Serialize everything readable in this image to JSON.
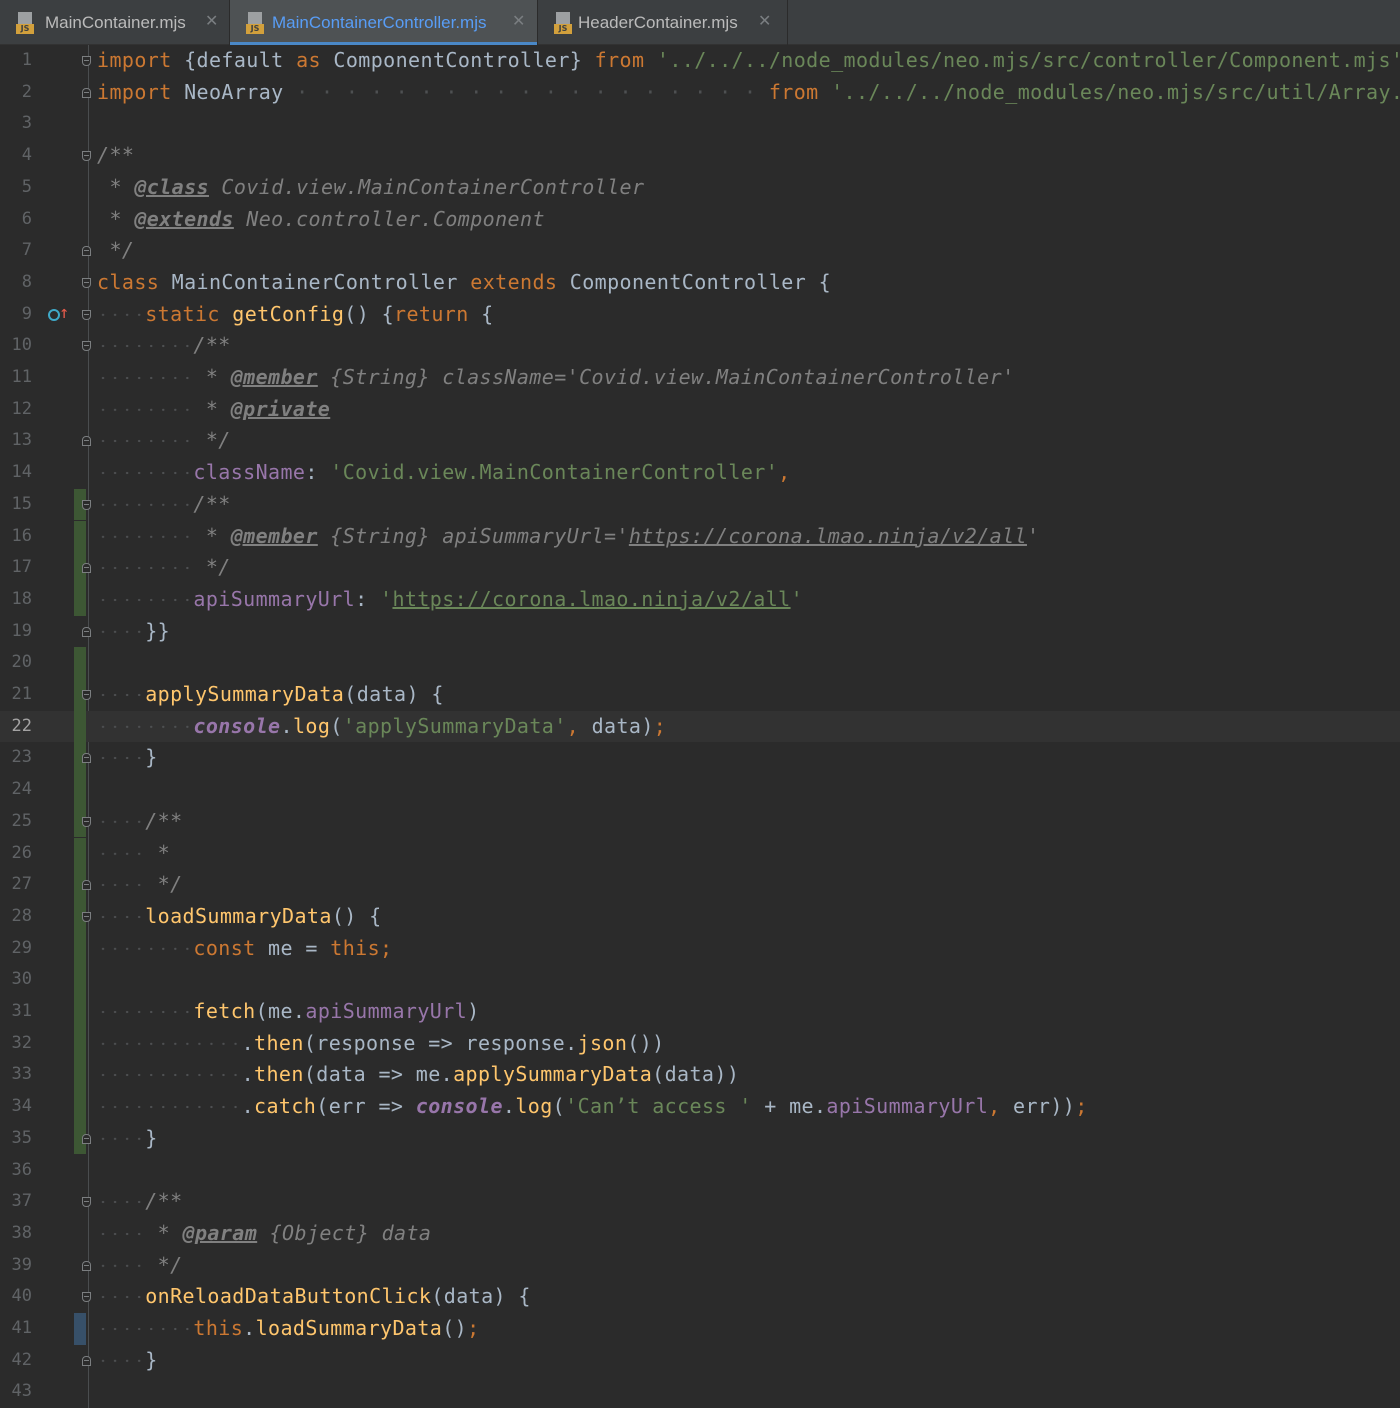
{
  "tabs": [
    {
      "label": "MainContainer.mjs",
      "active": false,
      "icon": "js-file-icon",
      "badge": "JS"
    },
    {
      "label": "MainContainerController.mjs",
      "active": true,
      "icon": "js-file-icon",
      "badge": "JS"
    },
    {
      "label": "HeaderContainer.mjs",
      "active": false,
      "icon": "js-file-icon",
      "badge": "JS"
    }
  ],
  "close_glyph": "✕",
  "editor": {
    "current_line": 22,
    "colors": {
      "keyword": "#cc7832",
      "string": "#6a8759",
      "comment": "#808080",
      "function": "#ffc66d",
      "property": "#9876aa",
      "text": "#a9b7c6",
      "background": "#2b2b2b",
      "gutter_added": "#3d5734",
      "gutter_modified": "#375069"
    },
    "lines": [
      {
        "n": "1",
        "indent": 0,
        "fold": "start",
        "tokens": [
          [
            "kw",
            "import"
          ],
          [
            "",
            " {default "
          ],
          [
            "kw",
            "as"
          ],
          [
            "",
            " ComponentController} "
          ],
          [
            "kw",
            "from"
          ],
          [
            "",
            " "
          ],
          [
            "str",
            "'../../../node_modules/neo.mjs/src/controller/Component.mjs'"
          ],
          [
            "kw",
            ";"
          ]
        ]
      },
      {
        "n": "2",
        "indent": 0,
        "fold": "end",
        "tokens": [
          [
            "kw",
            "import"
          ],
          [
            "",
            " NeoArray"
          ],
          [
            "ws",
            " · · · · · · · · · · · · · · · · · · ·"
          ],
          [
            "",
            " "
          ],
          [
            "kw",
            "from"
          ],
          [
            "",
            " "
          ],
          [
            "str",
            "'../../../node_modules/neo.mjs/src/util/Array.mjs'"
          ],
          [
            "kw",
            ";"
          ]
        ]
      },
      {
        "n": "3",
        "indent": 0,
        "tokens": []
      },
      {
        "n": "4",
        "indent": 0,
        "fold": "start",
        "tokens": [
          [
            "cmt",
            "/**"
          ]
        ]
      },
      {
        "n": "5",
        "indent": 0,
        "tokens": [
          [
            "cmt",
            " * "
          ],
          [
            "tag",
            "@class"
          ],
          [
            "cmt",
            " Covid.view.MainContainerController"
          ]
        ]
      },
      {
        "n": "6",
        "indent": 0,
        "tokens": [
          [
            "cmt",
            " * "
          ],
          [
            "tag",
            "@extends"
          ],
          [
            "cmt",
            " Neo.controller.Component"
          ]
        ]
      },
      {
        "n": "7",
        "indent": 0,
        "fold": "end",
        "tokens": [
          [
            "cmt",
            " */"
          ]
        ]
      },
      {
        "n": "8",
        "indent": 0,
        "fold": "start",
        "tokens": [
          [
            "kw",
            "class"
          ],
          [
            "",
            " MainContainerController "
          ],
          [
            "kw",
            "extends"
          ],
          [
            "",
            " ComponentController {"
          ]
        ]
      },
      {
        "n": "9",
        "indent": 4,
        "fold": "start",
        "marker": "override",
        "tokens": [
          [
            "kw",
            "static"
          ],
          [
            "",
            " "
          ],
          [
            "fn",
            "getConfig"
          ],
          [
            "",
            "() {"
          ],
          [
            "kw",
            "return"
          ],
          [
            "",
            " {"
          ]
        ]
      },
      {
        "n": "10",
        "indent": 8,
        "fold": "start",
        "tokens": [
          [
            "cmt",
            "/**"
          ]
        ]
      },
      {
        "n": "11",
        "indent": 8,
        "tokens": [
          [
            "cmt",
            " * "
          ],
          [
            "tag",
            "@member"
          ],
          [
            "cmt",
            " {String} className='Covid.view.MainContainerController'"
          ]
        ]
      },
      {
        "n": "12",
        "indent": 8,
        "tokens": [
          [
            "cmt",
            " * "
          ],
          [
            "tag",
            "@private"
          ]
        ]
      },
      {
        "n": "13",
        "indent": 8,
        "fold": "end",
        "tokens": [
          [
            "cmt",
            " */"
          ]
        ]
      },
      {
        "n": "14",
        "indent": 8,
        "tokens": [
          [
            "prop",
            "className"
          ],
          [
            "",
            ": "
          ],
          [
            "str",
            "'Covid.view.MainContainerController'"
          ],
          [
            "kw",
            ","
          ]
        ]
      },
      {
        "n": "15",
        "indent": 8,
        "fold": "start",
        "change": "added",
        "tokens": [
          [
            "cmt",
            "/**"
          ]
        ]
      },
      {
        "n": "16",
        "indent": 8,
        "change": "added",
        "tokens": [
          [
            "cmt",
            " * "
          ],
          [
            "tag",
            "@member"
          ],
          [
            "cmt",
            " {String} apiSummaryUrl='"
          ],
          [
            "cmturl",
            "https://corona.lmao.ninja/v2/all"
          ],
          [
            "cmt",
            "'"
          ]
        ]
      },
      {
        "n": "17",
        "indent": 8,
        "fold": "end",
        "change": "added",
        "tokens": [
          [
            "cmt",
            " */"
          ]
        ]
      },
      {
        "n": "18",
        "indent": 8,
        "change": "added",
        "tokens": [
          [
            "prop",
            "apiSummaryUrl"
          ],
          [
            "",
            ": "
          ],
          [
            "str",
            "'"
          ],
          [
            "strurl",
            "https://corona.lmao.ninja/v2/all"
          ],
          [
            "str",
            "'"
          ]
        ]
      },
      {
        "n": "19",
        "indent": 4,
        "fold": "end",
        "tokens": [
          [
            "",
            "}}"
          ]
        ]
      },
      {
        "n": "20",
        "indent": 0,
        "change": "added",
        "tokens": []
      },
      {
        "n": "21",
        "indent": 4,
        "fold": "start",
        "change": "added",
        "tokens": [
          [
            "fn",
            "applySummaryData"
          ],
          [
            "",
            "(data) {"
          ]
        ]
      },
      {
        "n": "22",
        "indent": 8,
        "change": "added",
        "tokens": [
          [
            "global",
            "console"
          ],
          [
            "",
            "."
          ],
          [
            "fn",
            "log"
          ],
          [
            "",
            "("
          ],
          [
            "str",
            "'applySummaryData'"
          ],
          [
            "kw",
            ","
          ],
          [
            "",
            " data)"
          ],
          [
            "kw",
            ";"
          ]
        ]
      },
      {
        "n": "23",
        "indent": 4,
        "fold": "end",
        "change": "added",
        "tokens": [
          [
            "",
            "}"
          ]
        ]
      },
      {
        "n": "24",
        "indent": 0,
        "change": "added",
        "tokens": []
      },
      {
        "n": "25",
        "indent": 4,
        "fold": "start",
        "change": "added",
        "tokens": [
          [
            "cmt",
            "/**"
          ]
        ]
      },
      {
        "n": "26",
        "indent": 4,
        "change": "added",
        "tokens": [
          [
            "cmt",
            " *"
          ]
        ]
      },
      {
        "n": "27",
        "indent": 4,
        "fold": "end",
        "change": "added",
        "tokens": [
          [
            "cmt",
            " */"
          ]
        ]
      },
      {
        "n": "28",
        "indent": 4,
        "fold": "start",
        "change": "added",
        "tokens": [
          [
            "fn",
            "loadSummaryData"
          ],
          [
            "",
            "() {"
          ]
        ]
      },
      {
        "n": "29",
        "indent": 8,
        "change": "added",
        "tokens": [
          [
            "kw",
            "const"
          ],
          [
            "",
            " me = "
          ],
          [
            "kw",
            "this;"
          ]
        ]
      },
      {
        "n": "30",
        "indent": 0,
        "change": "added",
        "tokens": []
      },
      {
        "n": "31",
        "indent": 8,
        "change": "added",
        "tokens": [
          [
            "fn",
            "fetch"
          ],
          [
            "",
            "(me."
          ],
          [
            "prop",
            "apiSummaryUrl"
          ],
          [
            "",
            ")"
          ]
        ]
      },
      {
        "n": "32",
        "indent": 12,
        "change": "added",
        "tokens": [
          [
            "",
            "."
          ],
          [
            "fn",
            "then"
          ],
          [
            "",
            "(response => response."
          ],
          [
            "fn",
            "json"
          ],
          [
            "",
            "())"
          ]
        ]
      },
      {
        "n": "33",
        "indent": 12,
        "change": "added",
        "tokens": [
          [
            "",
            "."
          ],
          [
            "fn",
            "then"
          ],
          [
            "",
            "(data => me."
          ],
          [
            "fn",
            "applySummaryData"
          ],
          [
            "",
            "(data))"
          ]
        ]
      },
      {
        "n": "34",
        "indent": 12,
        "change": "added",
        "tokens": [
          [
            "",
            "."
          ],
          [
            "fn",
            "catch"
          ],
          [
            "",
            "(err => "
          ],
          [
            "global",
            "console"
          ],
          [
            "",
            "."
          ],
          [
            "fn",
            "log"
          ],
          [
            "",
            "("
          ],
          [
            "str",
            "'Can’t access '"
          ],
          [
            "",
            " + me."
          ],
          [
            "prop",
            "apiSummaryUrl"
          ],
          [
            "kw",
            ","
          ],
          [
            "",
            " err))"
          ],
          [
            "kw",
            ";"
          ]
        ]
      },
      {
        "n": "35",
        "indent": 4,
        "fold": "end",
        "change": "added",
        "tokens": [
          [
            "",
            "}"
          ]
        ]
      },
      {
        "n": "36",
        "indent": 0,
        "tokens": []
      },
      {
        "n": "37",
        "indent": 4,
        "fold": "start",
        "tokens": [
          [
            "cmt",
            "/**"
          ]
        ]
      },
      {
        "n": "38",
        "indent": 4,
        "tokens": [
          [
            "cmt",
            " * "
          ],
          [
            "tag",
            "@param"
          ],
          [
            "cmt",
            " {Object} data"
          ]
        ]
      },
      {
        "n": "39",
        "indent": 4,
        "fold": "end",
        "tokens": [
          [
            "cmt",
            " */"
          ]
        ]
      },
      {
        "n": "40",
        "indent": 4,
        "fold": "start",
        "tokens": [
          [
            "fn",
            "onReloadDataButtonClick"
          ],
          [
            "",
            "(data) {"
          ]
        ]
      },
      {
        "n": "41",
        "indent": 8,
        "change": "modified",
        "tokens": [
          [
            "kw",
            "this"
          ],
          [
            "",
            "."
          ],
          [
            "fn",
            "loadSummaryData"
          ],
          [
            "",
            "()"
          ],
          [
            "kw",
            ";"
          ]
        ]
      },
      {
        "n": "42",
        "indent": 4,
        "fold": "end",
        "tokens": [
          [
            "",
            "}"
          ]
        ]
      },
      {
        "n": "43",
        "indent": 0,
        "tokens": []
      }
    ]
  }
}
